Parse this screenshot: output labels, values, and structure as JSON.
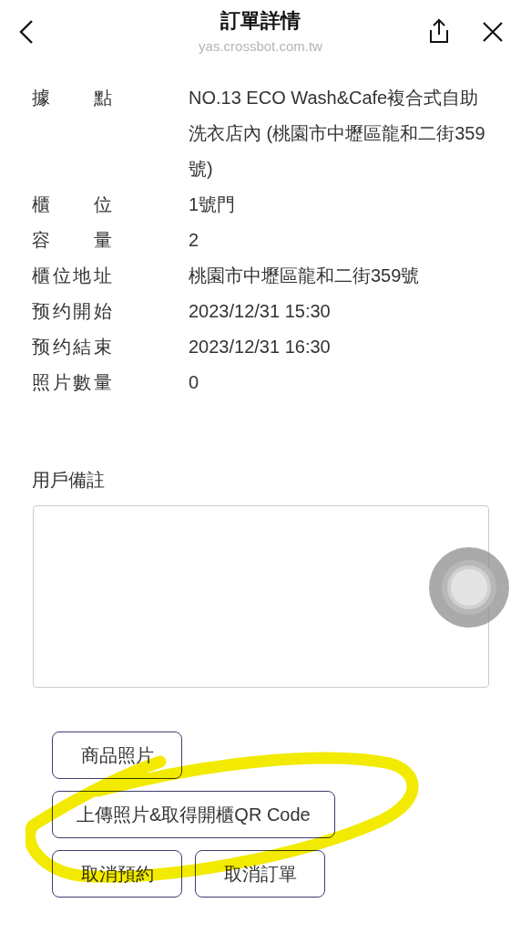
{
  "header": {
    "title": "訂單詳情",
    "url": "yas.crossbot.com.tw"
  },
  "details": [
    {
      "label": "據點",
      "value": "NO.13 ECO Wash&Cafe複合式自助洗衣店內 (桃園市中壢區龍和二街359號)"
    },
    {
      "label": "櫃位",
      "value": "1號門"
    },
    {
      "label": "容量",
      "value": "2"
    },
    {
      "label": "櫃位地址",
      "value": "桃園市中壢區龍和二街359號"
    },
    {
      "label": "预约開始",
      "value": "2023/12/31 15:30"
    },
    {
      "label": "预约結束",
      "value": "2023/12/31 16:30"
    },
    {
      "label": "照片數量",
      "value": "0"
    }
  ],
  "remark": {
    "label": "用戶備註"
  },
  "button_rows": [
    [
      {
        "label": "商品照片"
      }
    ],
    [
      {
        "label": "上傳照片&取得開櫃QR Code"
      }
    ],
    [
      {
        "label": "取消預約"
      },
      {
        "label": "取消訂單"
      }
    ]
  ]
}
